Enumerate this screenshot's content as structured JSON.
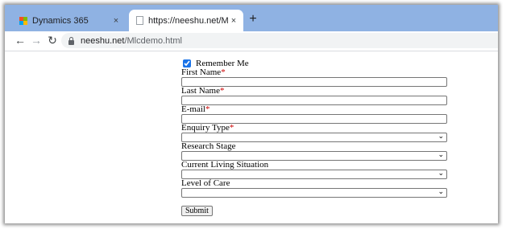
{
  "browser": {
    "tabs": [
      {
        "title": "Dynamics 365",
        "close": "×"
      },
      {
        "title": "https://neeshu.net/Mlcdemo.html",
        "close": "×"
      }
    ],
    "new_tab": "+",
    "nav": {
      "back": "←",
      "forward": "→",
      "reload": "↻"
    },
    "url": {
      "host": "neeshu.net",
      "path": "/Mlcdemo.html"
    }
  },
  "form": {
    "remember_me": {
      "label": "Remember Me",
      "checked": true
    },
    "fields": [
      {
        "label": "First Name",
        "required": "*",
        "type": "text",
        "value": ""
      },
      {
        "label": "Last Name",
        "required": "*",
        "type": "text",
        "value": ""
      },
      {
        "label": "E-mail",
        "required": "*",
        "type": "text",
        "value": ""
      },
      {
        "label": "Enquiry Type",
        "required": "*",
        "type": "select",
        "value": ""
      },
      {
        "label": "Research Stage",
        "required": "",
        "type": "select",
        "value": ""
      },
      {
        "label": "Current Living Situation",
        "required": "",
        "type": "select",
        "value": ""
      },
      {
        "label": "Level of Care",
        "required": "",
        "type": "select",
        "value": ""
      }
    ],
    "submit_label": "Submit"
  },
  "colors": {
    "tabstrip": "#8fb2e3",
    "required": "#cc0000",
    "checkbox": "#1a73e8"
  }
}
